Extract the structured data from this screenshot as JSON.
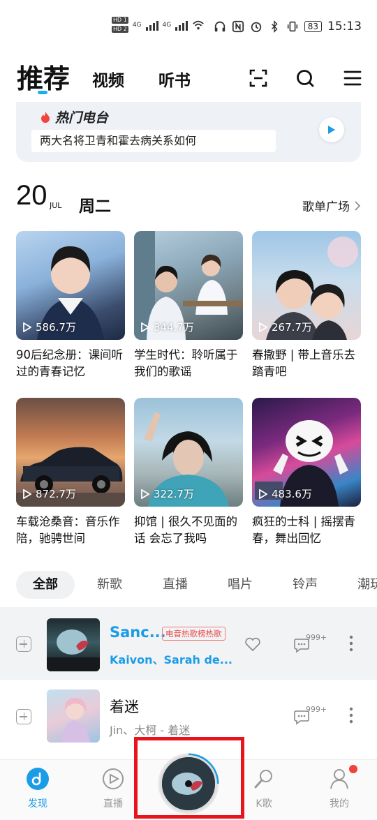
{
  "status_bar": {
    "hd1": "HD 1",
    "hd2": "HD 2",
    "net1": "4G",
    "net2": "4G",
    "battery": "83",
    "time": "15:13"
  },
  "top_nav": {
    "tabs": [
      {
        "label": "推荐",
        "active": true
      },
      {
        "label": "视频",
        "active": false
      },
      {
        "label": "听书",
        "active": false
      }
    ],
    "icons": [
      "scan-icon",
      "search-icon",
      "menu-icon"
    ]
  },
  "radio": {
    "title": "热门电台",
    "question": "两大名将卫青和霍去病关系如何"
  },
  "date": {
    "day": "20",
    "month": "JUL",
    "weekday": "周二"
  },
  "playlists_link": "歌单广场",
  "playlists": [
    {
      "count": "586.7万",
      "title": "90后纪念册：课间听过的青春记忆"
    },
    {
      "count": "344.7万",
      "title": "学生时代：聆听属于我们的歌谣"
    },
    {
      "count": "267.7万",
      "title": "春撒野 | 带上音乐去踏青吧"
    },
    {
      "count": "872.7万",
      "title": "车载沧桑音：音乐作陪，驰骋世间"
    },
    {
      "count": "322.7万",
      "title": "抑馆 | 很久不见面的话 会忘了我吗"
    },
    {
      "count": "483.6万",
      "title": "疯狂的士科 | 摇摆青春，舞出回忆"
    }
  ],
  "chips": [
    "全部",
    "新歌",
    "直播",
    "唱片",
    "铃声",
    "潮玩"
  ],
  "songs": [
    {
      "title": "Sanc...",
      "tag": "电音热歌榜热歌",
      "artist": "Kaivon、Sarah de...",
      "comments": "999+",
      "playing": true
    },
    {
      "title": "着迷",
      "tag": "",
      "artist": "Jin、大柯 - 着迷",
      "comments": "999+",
      "playing": false
    }
  ],
  "tab_bar": {
    "items": [
      {
        "label": "发现",
        "active": true
      },
      {
        "label": "直播",
        "active": false
      },
      {
        "label": "K歌",
        "active": false
      },
      {
        "label": "我的",
        "active": false
      }
    ]
  },
  "colors": {
    "accent": "#1a9de6",
    "highlight_box": "#e8141c",
    "tag_red": "#ea4b4b"
  }
}
